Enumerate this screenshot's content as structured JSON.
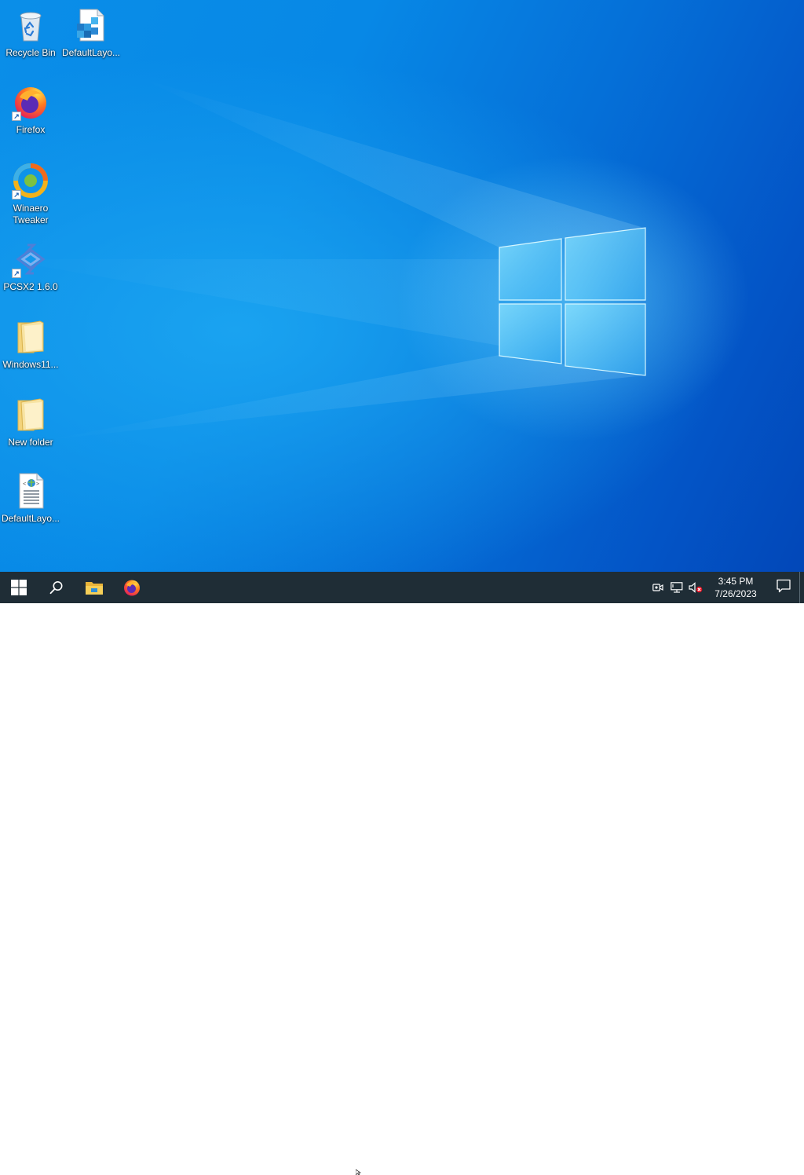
{
  "desktop": {
    "icons": [
      {
        "label": "Recycle Bin",
        "icon": "recycle-bin-icon",
        "shortcut": false
      },
      {
        "label": "DefaultLayo...",
        "icon": "registry-file-icon",
        "shortcut": false
      },
      {
        "label": "Firefox",
        "icon": "firefox-icon",
        "shortcut": true
      },
      {
        "label": "Winaero Tweaker",
        "icon": "winaero-tweaker-icon",
        "shortcut": true
      },
      {
        "label": "PCSX2 1.6.0",
        "icon": "pcsx2-icon",
        "shortcut": true
      },
      {
        "label": "Windows11...",
        "icon": "folder-icon",
        "shortcut": false
      },
      {
        "label": "New folder",
        "icon": "folder-icon",
        "shortcut": false
      },
      {
        "label": "DefaultLayo...",
        "icon": "xml-file-icon",
        "shortcut": false
      }
    ]
  },
  "taskbar": {
    "buttons": [
      {
        "name": "start",
        "icon": "windows-logo-icon"
      },
      {
        "name": "search",
        "icon": "search-icon"
      },
      {
        "name": "file-explorer",
        "icon": "file-explorer-icon"
      },
      {
        "name": "firefox",
        "icon": "firefox-icon"
      }
    ],
    "tray": {
      "icons": [
        "meet-now-icon",
        "network-icon",
        "volume-muted-icon"
      ],
      "time": "3:45 PM",
      "date": "7/26/2023",
      "notification_icon": "action-center-icon"
    }
  },
  "colors": {
    "taskbar_bg": "#1f2d36",
    "wallpaper_blue": "#0a8ee8",
    "accent_blue": "#0078d7"
  }
}
